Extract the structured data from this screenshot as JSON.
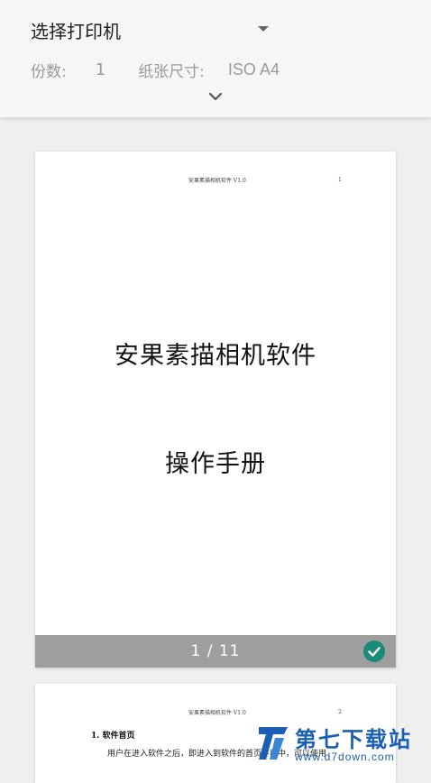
{
  "header": {
    "printer_select_label": "选择打印机",
    "copies_label": "份数:",
    "copies_value": "1",
    "paper_size_label": "纸张尺寸:",
    "paper_size_value": "ISO A4"
  },
  "preview": {
    "page1": {
      "running_header": "安果素描相机软件 V1.0",
      "page_number": "1",
      "title": "安果素描相机软件",
      "subtitle": "操作手册",
      "page_indicator": "1 / 11"
    },
    "page2": {
      "running_header": "安果素描相机软件 V1.0",
      "page_number": "2",
      "section_heading": "1. 软件首页",
      "body_text": "用户在进入软件之后，即进入到软件的首页界面中，可以使用"
    }
  },
  "watermark": {
    "brand": "第七下载站",
    "url": "www.d7down.com"
  },
  "colors": {
    "check_badge": "#1b8a78",
    "footer_bar": "#9e9e9e",
    "watermark": "#1a5fb4"
  }
}
